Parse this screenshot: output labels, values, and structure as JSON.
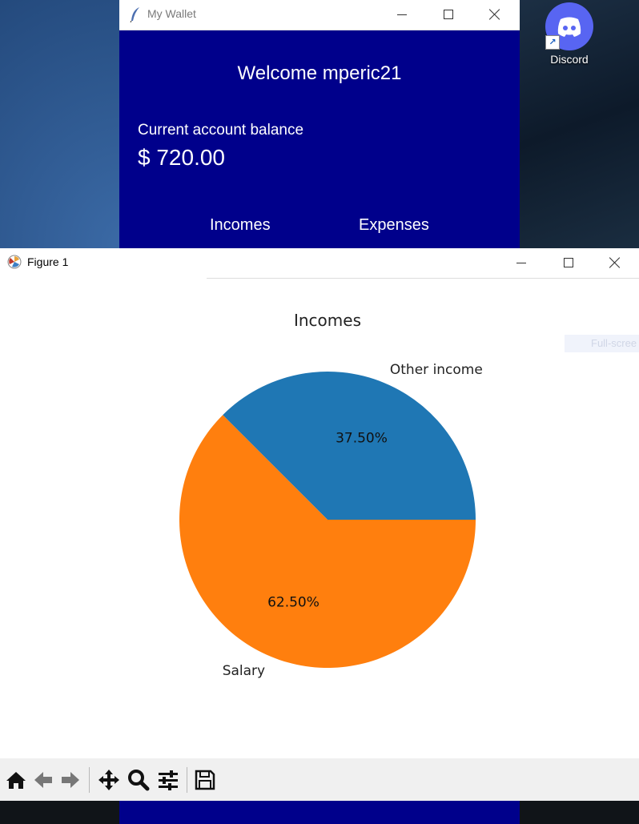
{
  "desktop": {
    "discord": {
      "label": "Discord",
      "icon": "discord-icon"
    }
  },
  "wallet_window": {
    "title": "My Wallet",
    "welcome": "Welcome mperic21",
    "balance_label": "Current account balance",
    "balance_value": "$ 720.00",
    "nav": {
      "incomes": "Incomes",
      "expenses": "Expenses"
    },
    "background_color": "#00008b"
  },
  "figure_window": {
    "title": "Figure 1",
    "fullscreen_hint": "Full-scree",
    "toolbar": [
      "home-icon",
      "back-arrow-icon",
      "forward-arrow-icon",
      "pan-icon",
      "zoom-icon",
      "configure-subplots-icon",
      "save-icon"
    ]
  },
  "chart_data": {
    "type": "pie",
    "title": "Incomes",
    "labels": [
      "Other income",
      "Salary"
    ],
    "values": [
      37.5,
      62.5
    ],
    "autopct": [
      "37.50%",
      "62.50%"
    ],
    "colors": [
      "#1f77b4",
      "#ff7f0e"
    ],
    "startangle": 0
  }
}
